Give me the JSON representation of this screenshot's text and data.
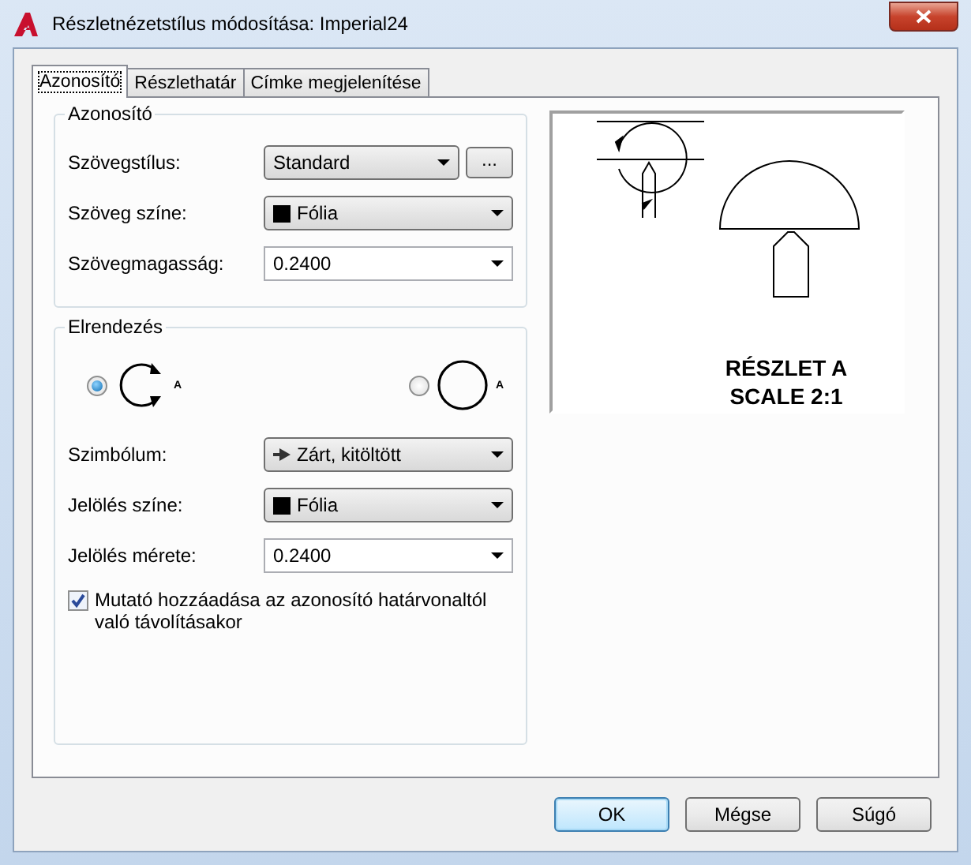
{
  "window": {
    "title": "Részletnézetstílus módosítása: Imperial24"
  },
  "tabs": [
    {
      "label": "Azonosító",
      "selected": true
    },
    {
      "label": "Részlethatár",
      "selected": false
    },
    {
      "label": "Címke megjelenítése",
      "selected": false
    }
  ],
  "identifier_group": {
    "title": "Azonosító",
    "fields": [
      {
        "kind": "select",
        "label": "Szövegstílus:",
        "value": "Standard",
        "browse": "..."
      },
      {
        "kind": "color",
        "label": "Szöveg színe:",
        "value": "Fólia"
      },
      {
        "kind": "edit",
        "label": "Szövegmagasság:",
        "value": "0.2400"
      }
    ]
  },
  "layout_group": {
    "title": "Elrendezés",
    "options": [
      {
        "kind": "arrows",
        "label": "A",
        "selected": true
      },
      {
        "kind": "plain",
        "label": "A",
        "selected": false
      }
    ],
    "fields": [
      {
        "kind": "symbol",
        "label": "Szimbólum:",
        "value": "Zárt, kitöltött"
      },
      {
        "kind": "color",
        "label": "Jelölés színe:",
        "value": "Fólia"
      },
      {
        "kind": "edit",
        "label": "Jelölés mérete:",
        "value": "0.2400"
      }
    ],
    "checkbox": {
      "label": "Mutató hozzáadása az azonosító határvonaltól való távolításakor",
      "checked": true
    }
  },
  "preview": {
    "caption_lines": [
      "RÉSZLET A",
      "SCALE 2:1"
    ]
  },
  "buttons": [
    {
      "label": "OK",
      "kind": "default"
    },
    {
      "label": "Mégse",
      "kind": "normal"
    },
    {
      "label": "Súgó",
      "kind": "normal"
    }
  ]
}
